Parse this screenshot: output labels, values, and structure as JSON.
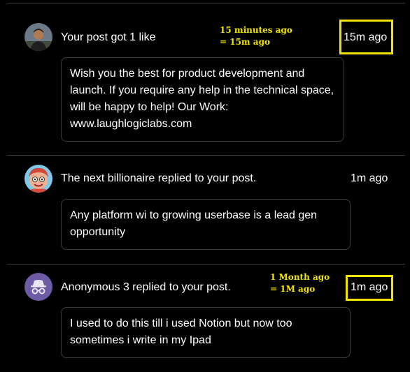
{
  "notifications": [
    {
      "avatar_icon": "person-photo-icon",
      "title": "Your post got 1 like",
      "time": "15m ago",
      "message": "Wish you the best for product development and launch. If you require any help in the technical space, will be happy to help! Our Work: www.laughlogiclabs.com"
    },
    {
      "avatar_icon": "cartoon-face-icon",
      "title": "The next billionaire replied to your post.",
      "time": "1m ago",
      "message": "Any platform wi to growing userbase is a lead gen opportunity"
    },
    {
      "avatar_icon": "incognito-icon",
      "title": "Anonymous 3 replied to your post.",
      "time": "1m ago",
      "message": "I used to do this till i used Notion but now too sometimes i write in my Ipad"
    }
  ],
  "annotations": {
    "first": {
      "line1": "15 minutes ago",
      "line2": "= 15m ago"
    },
    "third": {
      "line1": "1 Month ago",
      "line2": "= 1M ago"
    }
  },
  "colors": {
    "annotation": "#f2e600",
    "highlight_box": "#f2e600",
    "divider": "#3a3a3a",
    "bubble_border": "#3b3b3b",
    "incognito_avatar_bg": "#6d5ba6"
  }
}
